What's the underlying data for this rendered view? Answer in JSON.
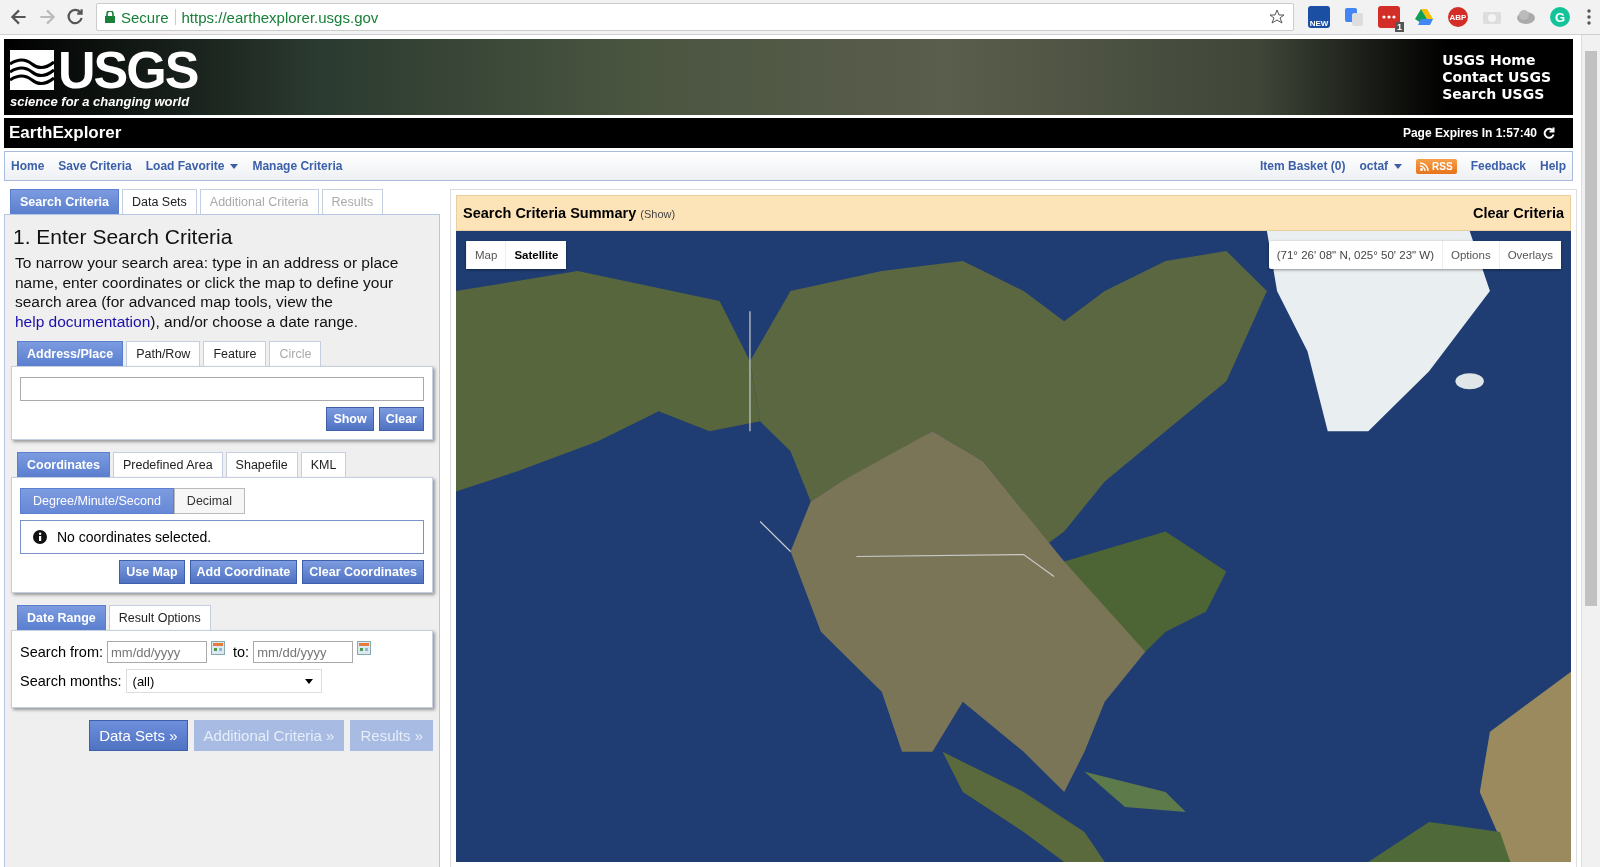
{
  "browser": {
    "security": "Secure",
    "url": "https://earthexplorer.usgs.gov",
    "extensions": [
      {
        "kind": "news",
        "label": "NEW"
      },
      {
        "kind": "translate"
      },
      {
        "kind": "lastpass",
        "badge": "1"
      },
      {
        "kind": "drive"
      },
      {
        "kind": "adblock",
        "label": "ABP"
      },
      {
        "kind": "camera"
      },
      {
        "kind": "globe"
      },
      {
        "kind": "grammarly",
        "label": "G"
      }
    ]
  },
  "banner": {
    "logo": "USGS",
    "tagline": "science for a changing world",
    "links": [
      "USGS Home",
      "Contact USGS",
      "Search USGS"
    ]
  },
  "title_bar": {
    "title": "EarthExplorer",
    "expires": "Page Expires In 1:57:40"
  },
  "nav": {
    "left": [
      {
        "label": "Home",
        "dropdown": false
      },
      {
        "label": "Save Criteria",
        "dropdown": false
      },
      {
        "label": "Load Favorite",
        "dropdown": true
      },
      {
        "label": "Manage Criteria",
        "dropdown": false
      }
    ],
    "right": [
      {
        "label": "Item Basket (0)",
        "kind": "link",
        "dropdown": false
      },
      {
        "label": "octaf",
        "kind": "link",
        "dropdown": true
      },
      {
        "label": "RSS",
        "kind": "rss",
        "dropdown": false
      },
      {
        "label": "Feedback",
        "kind": "link",
        "dropdown": false
      },
      {
        "label": "Help",
        "kind": "link",
        "dropdown": false
      }
    ]
  },
  "main_tabs": [
    {
      "label": "Search Criteria",
      "selected": true,
      "disabled": false
    },
    {
      "label": "Data Sets",
      "selected": false,
      "disabled": false
    },
    {
      "label": "Additional Criteria",
      "selected": false,
      "disabled": true
    },
    {
      "label": "Results",
      "selected": false,
      "disabled": true
    }
  ],
  "heading": "1. Enter Search Criteria",
  "intro": {
    "before": "To narrow your search area: type in an address or place name, enter coordinates or click the map to define your search area (for advanced map tools, view the ",
    "link": "help documentation",
    "after": "), and/or choose a date range."
  },
  "location_tabs": [
    {
      "label": "Address/Place",
      "selected": true,
      "disabled": false
    },
    {
      "label": "Path/Row",
      "selected": false,
      "disabled": false
    },
    {
      "label": "Feature",
      "selected": false,
      "disabled": false
    },
    {
      "label": "Circle",
      "selected": false,
      "disabled": true
    }
  ],
  "address_buttons": [
    "Show",
    "Clear"
  ],
  "coord_tabs": [
    {
      "label": "Coordinates",
      "selected": true,
      "disabled": false
    },
    {
      "label": "Predefined Area",
      "selected": false,
      "disabled": false
    },
    {
      "label": "Shapefile",
      "selected": false,
      "disabled": false
    },
    {
      "label": "KML",
      "selected": false,
      "disabled": false
    }
  ],
  "coord_format": [
    {
      "label": "Degree/Minute/Second",
      "selected": true
    },
    {
      "label": "Decimal",
      "selected": false
    }
  ],
  "coord_message": "No coordinates selected.",
  "coord_buttons": [
    "Use Map",
    "Add Coordinate",
    "Clear Coordinates"
  ],
  "date_tabs": [
    {
      "label": "Date Range",
      "selected": true,
      "disabled": false
    },
    {
      "label": "Result Options",
      "selected": false,
      "disabled": false
    }
  ],
  "date_range": {
    "from_label": "Search from:",
    "from_placeholder": "mm/dd/yyyy",
    "to_label": "to:",
    "to_placeholder": "mm/dd/yyyy",
    "months_label": "Search months:",
    "months_value": "(all)"
  },
  "step_buttons": [
    {
      "label": "Data Sets »",
      "disabled": false
    },
    {
      "label": "Additional Criteria »",
      "disabled": true
    },
    {
      "label": "Results »",
      "disabled": true
    }
  ],
  "summary": {
    "title": "Search Criteria Summary",
    "toggle": "(Show)",
    "clear": "Clear Criteria"
  },
  "map": {
    "types": [
      {
        "label": "Map",
        "selected": false
      },
      {
        "label": "Satellite",
        "selected": true
      }
    ],
    "coordinates": "(71° 26' 08\" N, 025° 50' 23\" W)",
    "controls": [
      "Options",
      "Overlays"
    ]
  }
}
